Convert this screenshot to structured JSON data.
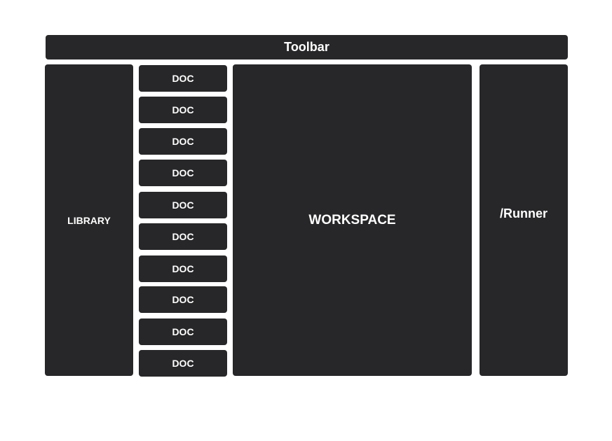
{
  "toolbar": {
    "label": "Toolbar"
  },
  "library": {
    "label": "LIBRARY"
  },
  "docs": [
    {
      "label": "DOC"
    },
    {
      "label": "DOC"
    },
    {
      "label": "DOC"
    },
    {
      "label": "DOC"
    },
    {
      "label": "DOC"
    },
    {
      "label": "DOC"
    },
    {
      "label": "DOC"
    },
    {
      "label": "DOC"
    },
    {
      "label": "DOC"
    },
    {
      "label": "DOC"
    }
  ],
  "workspace": {
    "label": "WORKSPACE"
  },
  "runner": {
    "label": "/Runner"
  },
  "colors": {
    "block": "#272729",
    "text": "#ffffff",
    "background": "#ffffff"
  }
}
